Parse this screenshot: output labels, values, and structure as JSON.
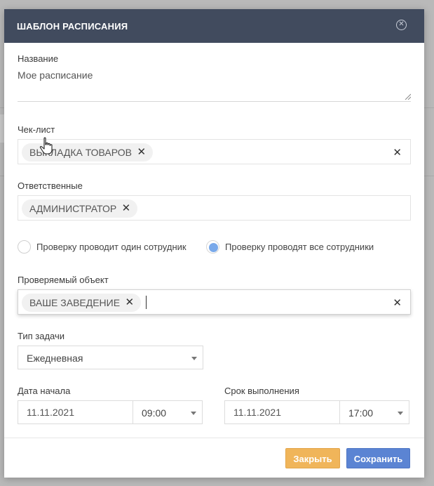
{
  "modal": {
    "title": "ШАБЛОН РАСПИСАНИЯ",
    "close_icon": "close-circle-icon"
  },
  "name_field": {
    "label": "Название",
    "value": "Мое расписание"
  },
  "checklist": {
    "label": "Чек-лист",
    "chip": "ВЫКЛАДКА ТОВАРОВ",
    "chip_remove": "✕",
    "clear": "✕"
  },
  "responsible": {
    "label": "Ответственные",
    "chip": "АДМИНИСТРАТОР",
    "chip_remove": "✕"
  },
  "check_mode": {
    "options": [
      {
        "label": "Проверку проводит один сотрудник",
        "selected": false
      },
      {
        "label": "Проверку проводят все сотрудники",
        "selected": true
      }
    ]
  },
  "object": {
    "label": "Проверяемый объект",
    "chip": "ВАШЕ ЗАВЕДЕНИЕ",
    "chip_remove": "✕",
    "clear": "✕"
  },
  "task_type": {
    "label": "Тип задачи",
    "value": "Ежедневная"
  },
  "start": {
    "label": "Дата начала",
    "date": "11.11.2021",
    "time": "09:00"
  },
  "deadline": {
    "label": "Срок выполнения",
    "date": "11.11.2021",
    "time": "17:00"
  },
  "buttons": {
    "close": "Закрыть",
    "save": "Сохранить"
  },
  "colors": {
    "header_bg": "#414b5e",
    "close_button": "#f0b55a",
    "save_button": "#5b84d3",
    "radio_selected": "#79a9ea"
  }
}
